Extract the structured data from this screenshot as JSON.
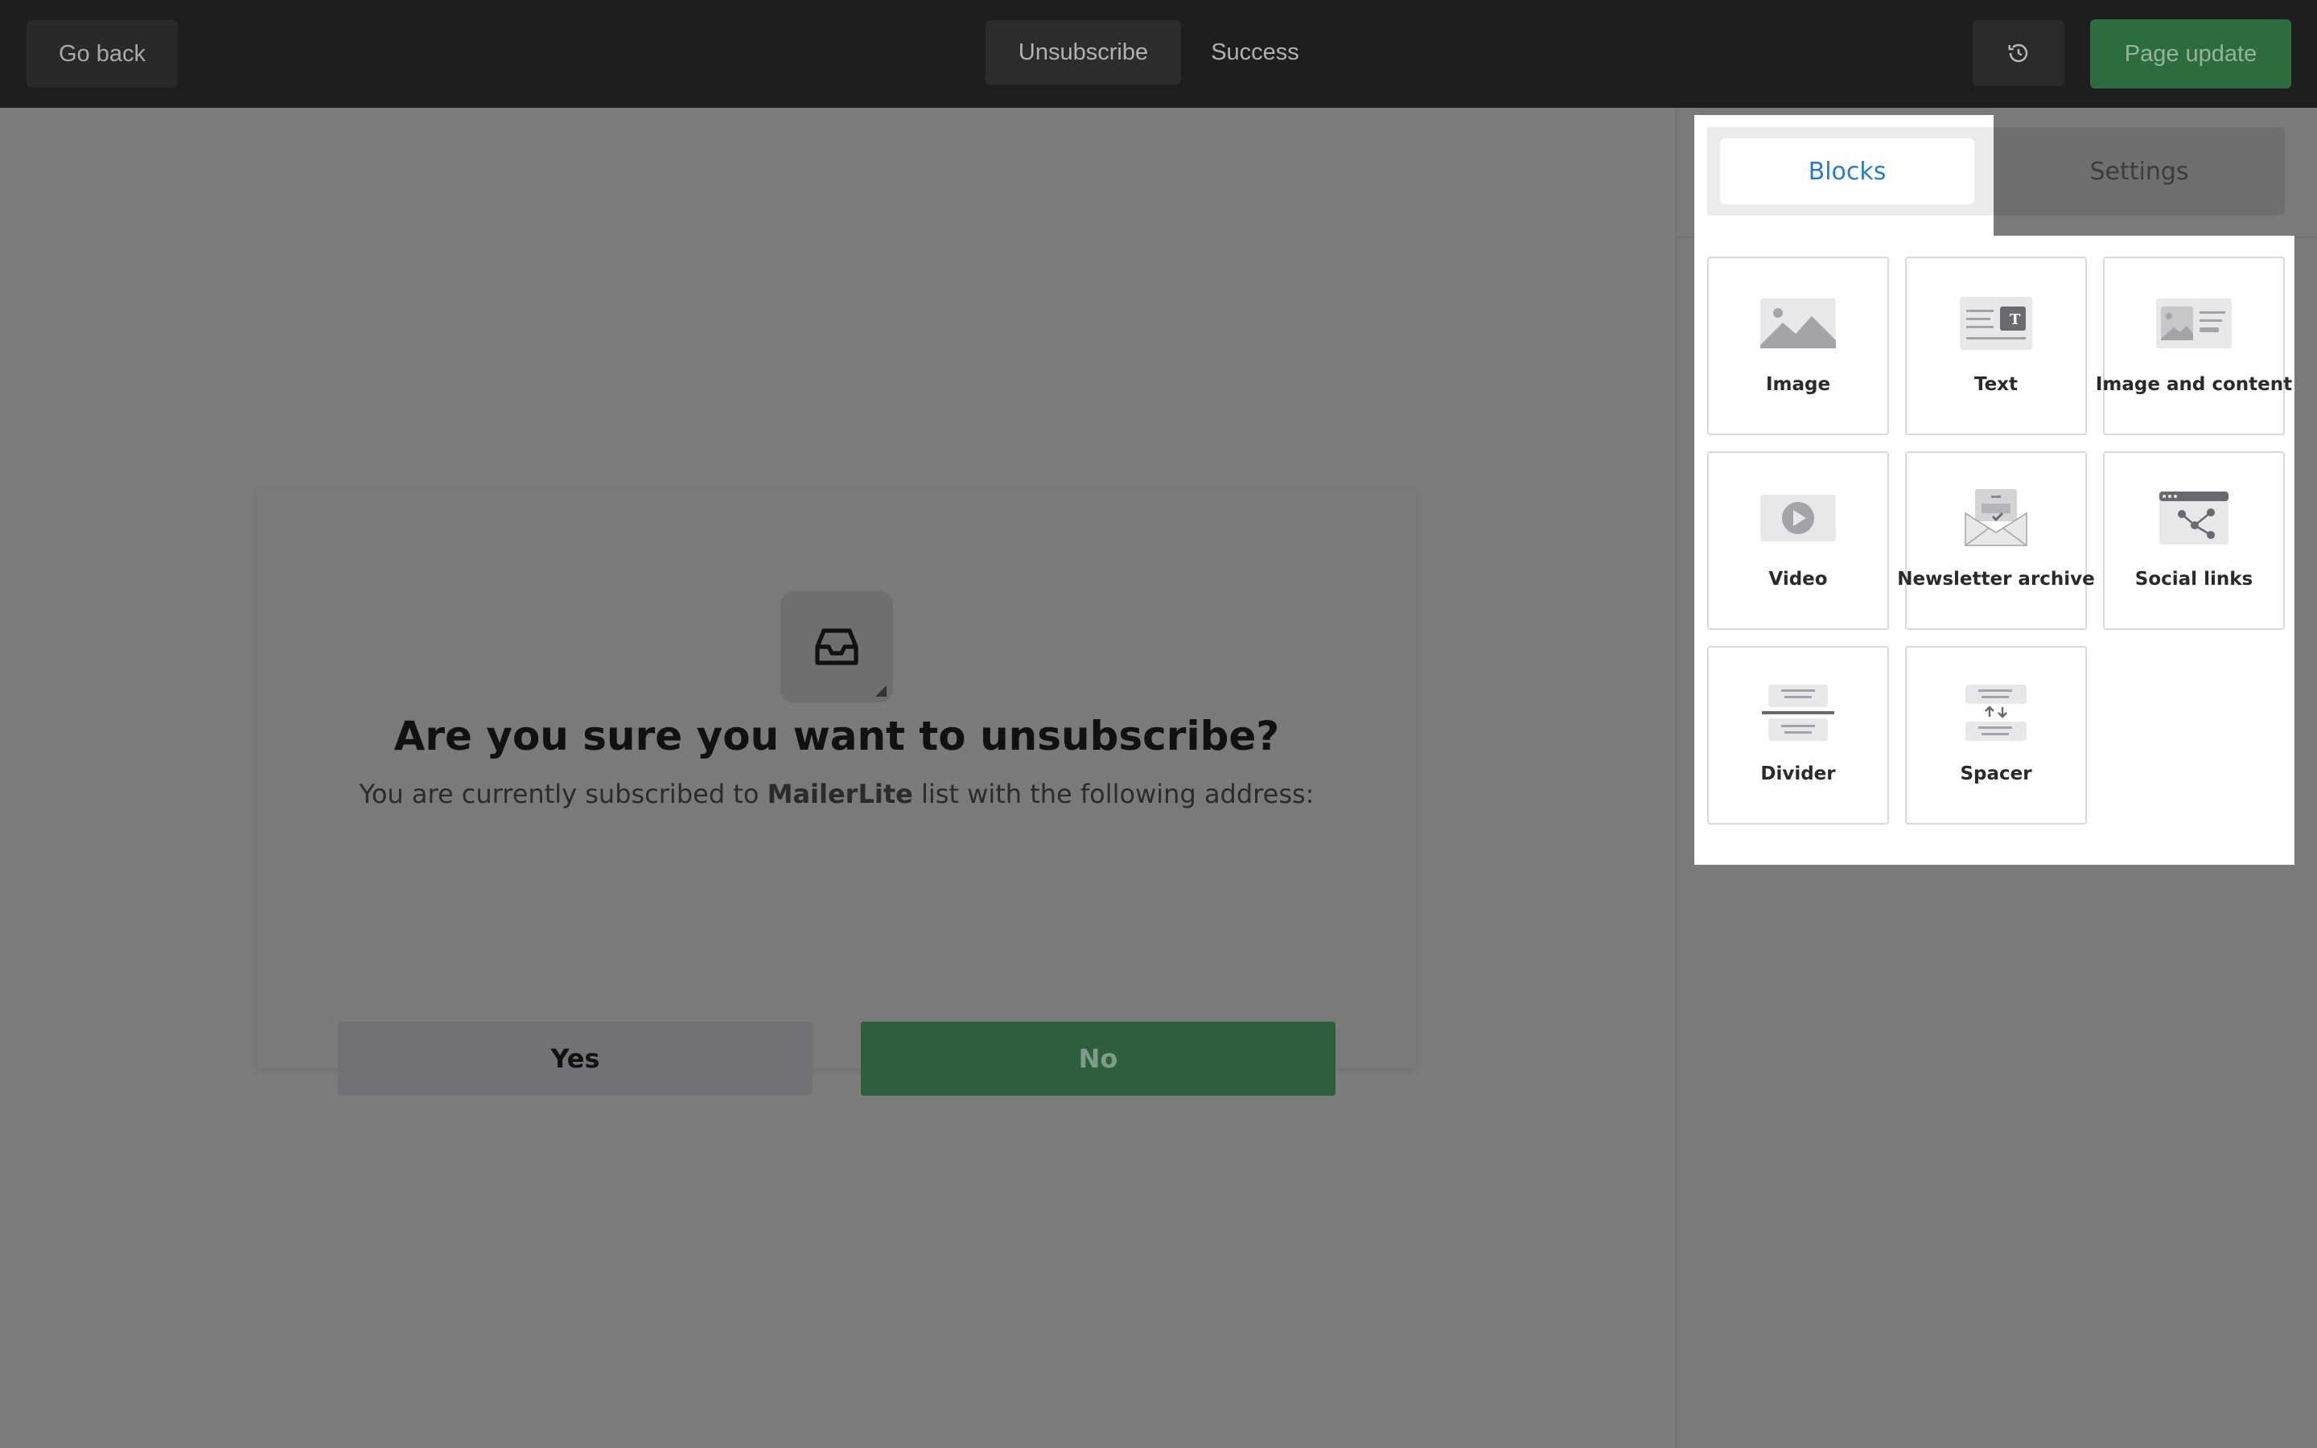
{
  "topbar": {
    "go_back": "Go back",
    "tabs": [
      {
        "label": "Unsubscribe"
      },
      {
        "label": "Success"
      }
    ],
    "history_icon": "history-icon",
    "page_update": "Page update"
  },
  "card": {
    "icon": "inbox-icon",
    "title": "Are you sure you want to unsubscribe?",
    "text_before": "You are currently subscribed to ",
    "text_brand": "MailerLite",
    "text_after": " list with the following address:",
    "yes_label": "Yes",
    "no_label": "No"
  },
  "sidebar": {
    "tabs": [
      {
        "label": "Blocks",
        "active": true
      },
      {
        "label": "Settings",
        "active": false
      }
    ],
    "blocks": [
      {
        "label": "Image",
        "icon": "image-icon"
      },
      {
        "label": "Text",
        "icon": "text-icon"
      },
      {
        "label": "Image and content",
        "icon": "image-and-content-icon"
      },
      {
        "label": "Video",
        "icon": "video-icon"
      },
      {
        "label": "Newsletter archive",
        "icon": "newsletter-archive-icon"
      },
      {
        "label": "Social links",
        "icon": "social-links-icon"
      },
      {
        "label": "Divider",
        "icon": "divider-icon"
      },
      {
        "label": "Spacer",
        "icon": "spacer-icon"
      }
    ]
  },
  "colors": {
    "accent_green": "#2e6b3e",
    "active_tab_blue": "#2a7bc6"
  }
}
